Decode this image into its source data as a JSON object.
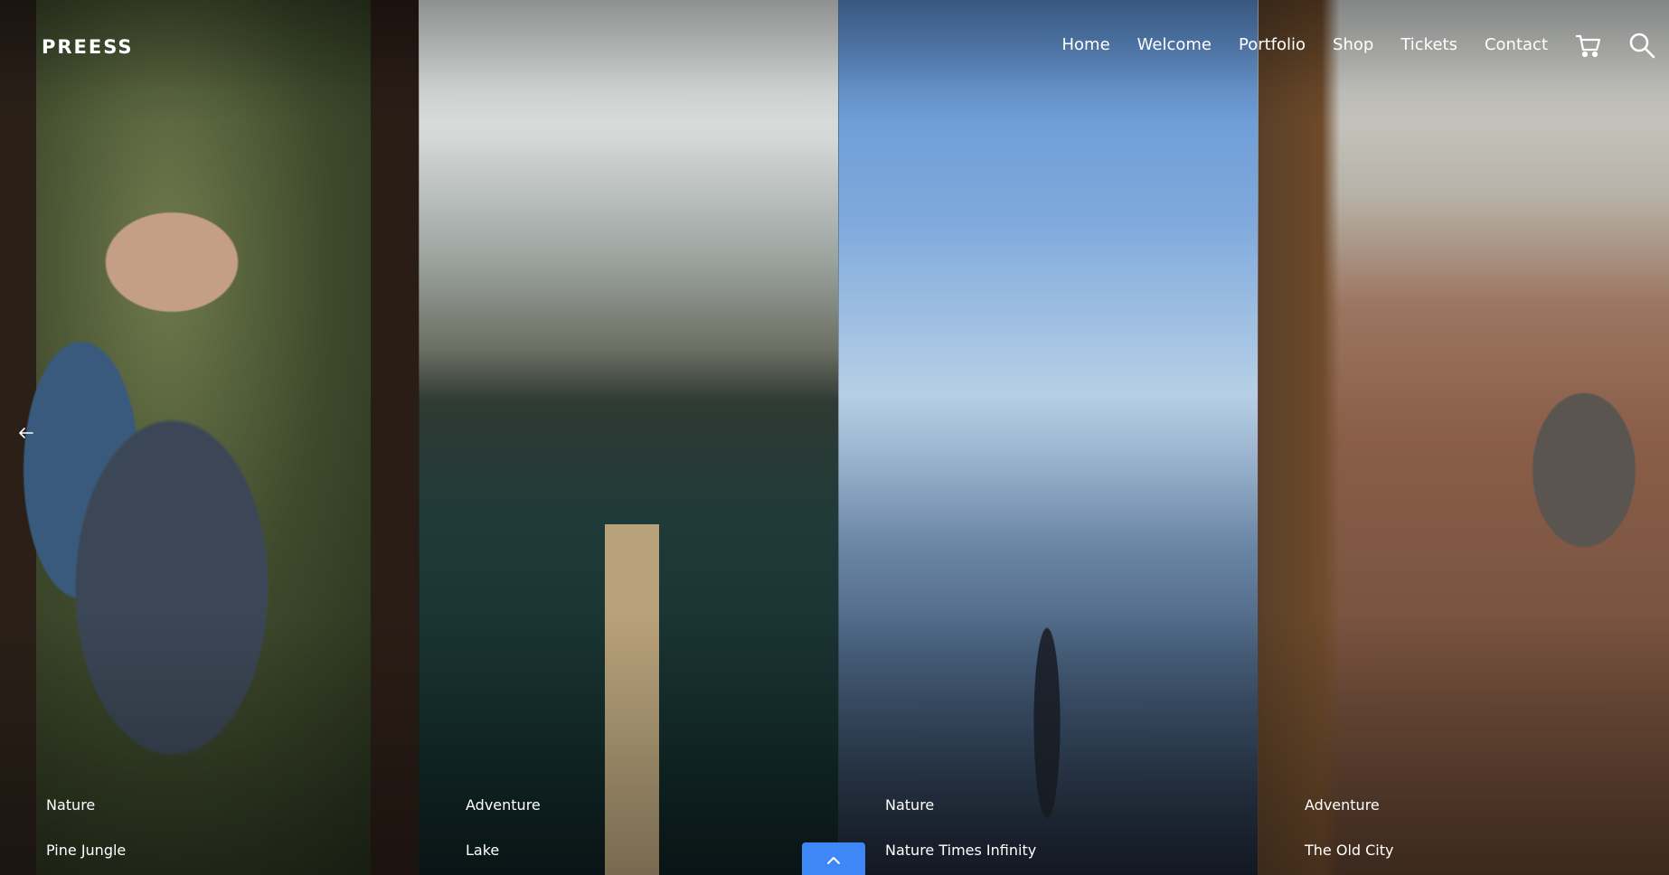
{
  "header": {
    "logo": "PREESS",
    "nav": [
      "Home",
      "Welcome",
      "Portfolio",
      "Shop",
      "Tickets",
      "Contact"
    ],
    "icons": {
      "cart": "cart-icon",
      "search": "search-icon"
    }
  },
  "slider": {
    "prev_icon": "arrow-left-icon",
    "panels": [
      {
        "category": "Nature",
        "title": "Pine Jungle"
      },
      {
        "category": "Adventure",
        "title": "Lake"
      },
      {
        "category": "Nature",
        "title": "Nature Times Infinity"
      },
      {
        "category": "Adventure",
        "title": "The Old City"
      }
    ]
  },
  "scroll_top": {
    "icon": "chevron-up-icon",
    "color": "#3e87f7"
  }
}
